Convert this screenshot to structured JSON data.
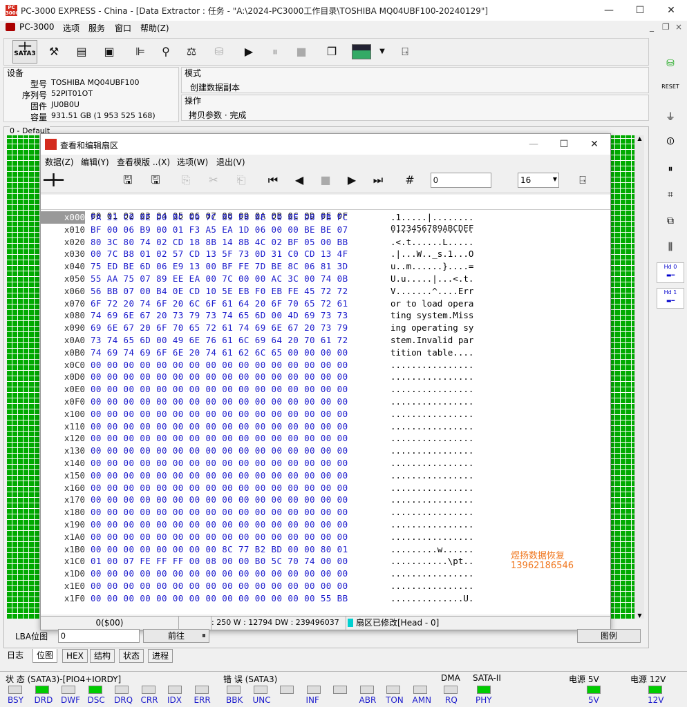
{
  "titlebar": {
    "title": "PC-3000 EXPRESS - China - [Data Extractor : 任务 - \"A:\\2024-PC3000工作目录\\TOSHIBA MQ04UBF100-20240129\"]",
    "app_icon_text": "PC 3000",
    "min": "—",
    "max": "☐",
    "close": "✕"
  },
  "menubar": {
    "app": "PC-3000",
    "items": [
      "选项",
      "服务",
      "窗口",
      "帮助(Z)"
    ],
    "mdi_min": "_",
    "mdi_restore": "❐",
    "mdi_close": "×"
  },
  "toolbar": {
    "sata_label": "SATA3",
    "dropdown_arrow": "▼"
  },
  "device": {
    "legend": "设备",
    "rows": [
      {
        "k": "型号",
        "v": "TOSHIBA MQ04UBF100"
      },
      {
        "k": "序列号",
        "v": "52PIT01OT"
      },
      {
        "k": "固件",
        "v": "JU0B0U"
      },
      {
        "k": "容量",
        "v": "931.51 GB (1 953 525 168)"
      }
    ]
  },
  "mode": {
    "legend": "模式",
    "value": "创建数据副本"
  },
  "operation": {
    "legend": "操作",
    "value": "拷贝参数 · 完成"
  },
  "map": {
    "legend": "0 - Default"
  },
  "rightbar": {
    "reset_label": "RESET",
    "hd0": "Hd 0",
    "hd1": "Hd 1"
  },
  "editor": {
    "title": "查看和编辑扇区",
    "close": "✕",
    "max": "☐",
    "min": "—",
    "menu": [
      "数据(Z)",
      "编辑(Y)",
      "查看模版 ..(X)",
      "选项(W)",
      "退出(V)"
    ],
    "goto_value": "0",
    "cols_value": "16",
    "header": {
      "bytes": "00 01 02 03 04 05 06 07 08 09 0A 0B 0C 0D 0E 0F",
      "ascii": "0123456789ABCDEF"
    },
    "rows": [
      {
        "o": "x000",
        "b": "FA 31 C0 8E D0 BC 00 7C 89 E6 8E C0 8E D8 FB FC",
        "a": ".1.....|........"
      },
      {
        "o": "x010",
        "b": "BF 00 06 B9 00 01 F3 A5 EA 1D 06 00 00 BE BE 07",
        "a": "................"
      },
      {
        "o": "x020",
        "b": "80 3C 80 74 02 CD 18 8B 14 8B 4C 02 BF 05 00 BB",
        ".a": "",
        "a": ".<.t......L....."
      },
      {
        "o": "x030",
        "b": "00 7C B8 01 02 57 CD 13 5F 73 0D 31 C0 CD 13 4F",
        "a": ".|...W.._s.1...O"
      },
      {
        "o": "x040",
        "b": "75 ED BE 6D 06 E9 13 00 BF FE 7D BE 8C 06 81 3D",
        "a": "u..m......}....="
      },
      {
        "o": "x050",
        "b": "55 AA 75 07 89 EE EA 00 7C 00 00 AC 3C 00 74 0B",
        "a": "U.u.....|...<.t."
      },
      {
        "o": "x060",
        "b": "56 BB 07 00 B4 0E CD 10 5E EB F0 EB FE 45 72 72",
        "a": "V.......^....Err"
      },
      {
        "o": "x070",
        "b": "6F 72 20 74 6F 20 6C 6F 61 64 20 6F 70 65 72 61",
        "a": "or to load opera"
      },
      {
        "o": "x080",
        "b": "74 69 6E 67 20 73 79 73 74 65 6D 00 4D 69 73 73",
        "a": "ting system.Miss"
      },
      {
        "o": "x090",
        "b": "69 6E 67 20 6F 70 65 72 61 74 69 6E 67 20 73 79",
        "a": "ing operating sy"
      },
      {
        "o": "x0A0",
        "b": "73 74 65 6D 00 49 6E 76 61 6C 69 64 20 70 61 72",
        "a": "stem.Invalid par"
      },
      {
        "o": "x0B0",
        "b": "74 69 74 69 6F 6E 20 74 61 62 6C 65 00 00 00 00",
        "a": "tition table...."
      },
      {
        "o": "x0C0",
        "b": "00 00 00 00 00 00 00 00 00 00 00 00 00 00 00 00",
        "a": "................"
      },
      {
        "o": "x0D0",
        "b": "00 00 00 00 00 00 00 00 00 00 00 00 00 00 00 00",
        "a": "................"
      },
      {
        "o": "x0E0",
        "b": "00 00 00 00 00 00 00 00 00 00 00 00 00 00 00 00",
        "a": "................"
      },
      {
        "o": "x0F0",
        "b": "00 00 00 00 00 00 00 00 00 00 00 00 00 00 00 00",
        "a": "................"
      },
      {
        "o": "x100",
        "b": "00 00 00 00 00 00 00 00 00 00 00 00 00 00 00 00",
        "a": "................"
      },
      {
        "o": "x110",
        "b": "00 00 00 00 00 00 00 00 00 00 00 00 00 00 00 00",
        "a": "................"
      },
      {
        "o": "x120",
        "b": "00 00 00 00 00 00 00 00 00 00 00 00 00 00 00 00",
        "a": "................"
      },
      {
        "o": "x130",
        "b": "00 00 00 00 00 00 00 00 00 00 00 00 00 00 00 00",
        "a": "................"
      },
      {
        "o": "x140",
        "b": "00 00 00 00 00 00 00 00 00 00 00 00 00 00 00 00",
        "a": "................"
      },
      {
        "o": "x150",
        "b": "00 00 00 00 00 00 00 00 00 00 00 00 00 00 00 00",
        "a": "................"
      },
      {
        "o": "x160",
        "b": "00 00 00 00 00 00 00 00 00 00 00 00 00 00 00 00",
        "a": "................"
      },
      {
        "o": "x170",
        "b": "00 00 00 00 00 00 00 00 00 00 00 00 00 00 00 00",
        "a": "................"
      },
      {
        "o": "x180",
        "b": "00 00 00 00 00 00 00 00 00 00 00 00 00 00 00 00",
        "a": "................"
      },
      {
        "o": "x190",
        "b": "00 00 00 00 00 00 00 00 00 00 00 00 00 00 00 00",
        "a": "................"
      },
      {
        "o": "x1A0",
        "b": "00 00 00 00 00 00 00 00 00 00 00 00 00 00 00 00",
        "a": "................"
      },
      {
        "o": "x1B0",
        "b": "00 00 00 00 00 00 00 00 8C 77 B2 BD 00 00 80 01",
        "a": ".........w......"
      },
      {
        "o": "x1C0",
        "b": "01 00 07 FE FF FF 00 08 00 00 B0 5C 70 74 00 00",
        "a": "...........\\pt.."
      },
      {
        "o": "x1D0",
        "b": "00 00 00 00 00 00 00 00 00 00 00 00 00 00 00 00",
        "a": "................"
      },
      {
        "o": "x1E0",
        "b": "00 00 00 00 00 00 00 00 00 00 00 00 00 00 00 00",
        "a": "................"
      },
      {
        "o": "x1F0",
        "b": "00 00 00 00 00 00 00 00 00 00 00 00 00 00 55 BB",
        "a": "..............U."
      }
    ],
    "watermark_line1": "煜扬数据恢复",
    "watermark_line2": "13962186546",
    "status_pos": "0($00)",
    "status_info": ": 250 W : 12794 DW : 239496037",
    "status_mod": "扇区已修改[Head - 0]"
  },
  "lba": {
    "label": "LBA位图",
    "value": "0",
    "goto": "前往",
    "pause": "⏸",
    "legend_btn": "图例"
  },
  "bottom_tabs": [
    "日志",
    "位图",
    "HEX",
    "结构",
    "状态",
    "进程"
  ],
  "status": {
    "group1": "状 态 (SATA3)-[PIO4+IORDY]",
    "g1": [
      {
        "l": "BSY",
        "on": false
      },
      {
        "l": "DRD",
        "on": true
      },
      {
        "l": "DWF",
        "on": false
      },
      {
        "l": "DSC",
        "on": true
      },
      {
        "l": "DRQ",
        "on": false
      },
      {
        "l": "CRR",
        "on": false
      },
      {
        "l": "IDX",
        "on": false
      },
      {
        "l": "ERR",
        "on": false
      }
    ],
    "group2": "错 误 (SATA3)",
    "g2": [
      {
        "l": "BBK",
        "on": false
      },
      {
        "l": "UNC",
        "on": false
      },
      {
        "l": "",
        "on": false
      },
      {
        "l": "INF",
        "on": false
      },
      {
        "l": "",
        "on": false
      },
      {
        "l": "ABR",
        "on": false
      },
      {
        "l": "TON",
        "on": false
      },
      {
        "l": "AMN",
        "on": false
      }
    ],
    "dma": "DMA",
    "dma_rq": "RQ",
    "sata2": "SATA-II",
    "phy": "PHY",
    "p5": "电源 5V",
    "p5v": "5V",
    "p12": "电源 12V",
    "p12v": "12V"
  },
  "colors": {
    "map_green": "#00aa00",
    "hex_blue": "#1a1acc",
    "watermark": "#f07820"
  }
}
